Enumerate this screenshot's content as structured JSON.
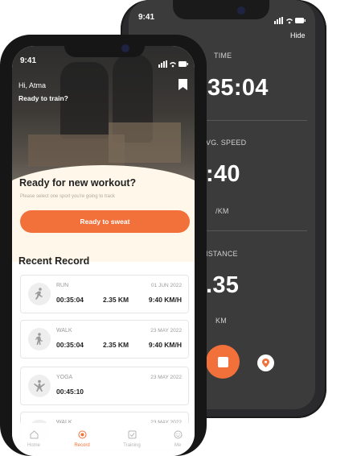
{
  "back": {
    "time": "9:41",
    "hide_label": "Hide",
    "time_label": "TIME",
    "time_value": "35:04",
    "speed_label": "VG. SPEED",
    "speed_value": ":40",
    "speed_unit": "/KM",
    "distance_label": "ISTANCE",
    "distance_value": ".35",
    "distance_unit": "KM",
    "colors": {
      "accent": "#f2703a",
      "screen": "#3b3b3b"
    }
  },
  "front": {
    "time": "9:41",
    "greeting": "Hi, Atma",
    "subtitle": "Ready to train?",
    "new_workout_title": "Ready for new workout?",
    "new_workout_hint": "Please select one sport you're going to track",
    "cta_label": "Ready to sweat",
    "recent_title": "Recent Record",
    "records": [
      {
        "sport": "RUN",
        "date": "01 JUN 2022",
        "duration": "00:35:04",
        "distance": "2.35 KM",
        "pace": "9:40 KM/H",
        "icon": "running-icon"
      },
      {
        "sport": "WALK",
        "date": "23 MAY 2022",
        "duration": "00:35:04",
        "distance": "2.35 KM",
        "pace": "9:40 KM/H",
        "icon": "walking-icon"
      },
      {
        "sport": "YOGA",
        "date": "23 MAY 2022",
        "duration": "00:45:10",
        "distance": "",
        "pace": "",
        "icon": "yoga-icon"
      },
      {
        "sport": "WALK",
        "date": "23 MAY 2022",
        "duration": "",
        "distance": "",
        "pace": "",
        "icon": "walking-icon"
      }
    ],
    "tabs": [
      {
        "label": "Home",
        "icon": "home-icon",
        "active": false
      },
      {
        "label": "Record",
        "icon": "record-icon",
        "active": true
      },
      {
        "label": "Training",
        "icon": "checklist-icon",
        "active": false
      },
      {
        "label": "Me",
        "icon": "smile-icon",
        "active": false
      }
    ],
    "colors": {
      "accent": "#f2703a",
      "cream": "#fff8ea"
    }
  }
}
